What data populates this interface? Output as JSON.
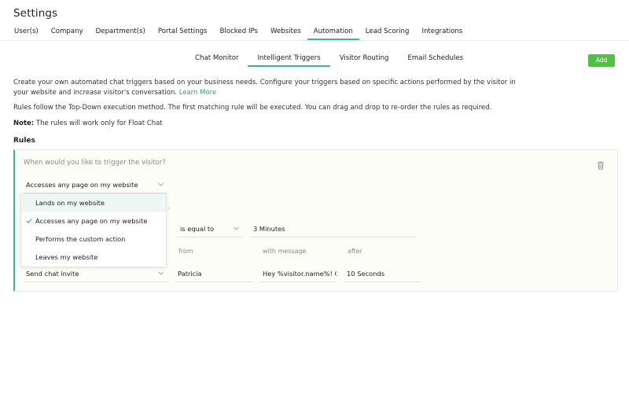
{
  "page": {
    "title": "Settings"
  },
  "main_tabs": [
    {
      "label": "User(s)"
    },
    {
      "label": "Company"
    },
    {
      "label": "Department(s)"
    },
    {
      "label": "Portal Settings"
    },
    {
      "label": "Blocked IPs"
    },
    {
      "label": "Websites"
    },
    {
      "label": "Automation"
    },
    {
      "label": "Lead Scoring"
    },
    {
      "label": "Integrations"
    }
  ],
  "active_main_tab": "Automation",
  "sub_tabs": [
    {
      "label": "Chat Monitor"
    },
    {
      "label": "Intelligent Triggers"
    },
    {
      "label": "Visitor Routing"
    },
    {
      "label": "Email Schedules"
    }
  ],
  "active_sub_tab": "Intelligent Triggers",
  "add_button": {
    "label": "Add"
  },
  "description": {
    "text": "Create your own automated chat triggers based on your business needs. Configure your triggers based on specific actions performed by the visitor in your website and increase visitor's conversation.",
    "link": "Learn More"
  },
  "rules_note": "Rules follow the Top-Down execution method. The first matching rule will be executed. You can drag and drop to re-order the rules as required.",
  "note": {
    "label": "Note:",
    "text": "The rules will work only for Float Chat"
  },
  "rules_title": "Rules",
  "rule": {
    "question": "When would you like to trigger the visitor?",
    "trigger_select": {
      "value": "Accesses any page on my website"
    },
    "dropdown_options": [
      {
        "label": "Lands on my website"
      },
      {
        "label": "Accesses any page on my website"
      },
      {
        "label": "Performs the custom action"
      },
      {
        "label": "Leaves my website"
      }
    ],
    "selected_option": "Accesses any page on my website",
    "hovered_option": "Lands on my website",
    "condition": {
      "operator": "is equal to",
      "value": "3 Minutes"
    },
    "action_labels": {
      "from": "from",
      "message": "with message",
      "after": "after"
    },
    "action": {
      "type": "Send chat invite",
      "from": "Patricia",
      "message": "Hey %visitor.name%! Can",
      "after": "10 Seconds"
    },
    "stray_text": "."
  },
  "colors": {
    "accent": "#38b39c",
    "add_button": "#52c047",
    "link": "#2e9b8a"
  },
  "icons": {
    "delete": "trash-icon",
    "dropdown": "chevron-down-icon",
    "selected": "check-icon"
  }
}
